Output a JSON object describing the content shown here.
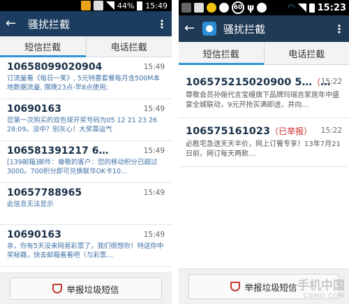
{
  "left": {
    "status": {
      "battery": "44%",
      "time": "15:49"
    },
    "appbar": {
      "title": "骚扰拦截"
    },
    "tabs": [
      {
        "label": "短信拦截"
      },
      {
        "label": "电话拦截"
      }
    ],
    "messages": [
      {
        "number": "10658099020904",
        "time": "15:49",
        "preview": "订流量看《每日一笑》, 5元特惠套餐每月含500M本地数据流量, 限晚23点-早8点使用;"
      },
      {
        "number": "10690163",
        "time": "15:49",
        "preview": "您第一次购买的双色球开奖号码为05 12 21 23 26 28:09。没中？别灰心！大奖靠运气"
      },
      {
        "number": "106581391217 6313…",
        "time": "15:49",
        "preview": "[139邮箱]邮件：尊敬的客户：您的移动积分已超过3000。700积分即可兑换联华OK卡10…"
      },
      {
        "number": "10657788965",
        "time": "15:49",
        "preview": "此信息无法显示"
      },
      {
        "number": "10690163",
        "time": "15:49",
        "preview": "亲，你有5天没来网易彩票了，我们很想你！特送你中奖秘籍，快去邮箱看看吧（与彩票…"
      }
    ],
    "report_button": "举报垃圾短信"
  },
  "right": {
    "status": {
      "badge": "60",
      "time": "15:23"
    },
    "appbar": {
      "title": "骚扰拦截"
    },
    "tabs": [
      {
        "label": "短信拦截"
      },
      {
        "label": "电话拦截"
      }
    ],
    "messages": [
      {
        "number": "106575215020900 5…",
        "tag": "（已举报）",
        "time": "15:22",
        "preview": "尊敬会员孙俪代言宝缦旗下品牌玛瑞吉家居年中盛宴全城联动，9元开抢买满即送，并向…"
      },
      {
        "number": "106575161023",
        "tag": "（已举报）",
        "time": "15:22",
        "preview": "必胜宅急送天天半价，网上订餐专享！13年7月21日前，网订每天两款…"
      }
    ],
    "report_button": "举报垃圾短信"
  },
  "watermark": {
    "main": "手机中国",
    "sub": "CNMO.COM"
  },
  "colors": {
    "appbar": "#1c3d5f",
    "tab_indicator": "#2f95d6",
    "reported_tag": "#d12a2a",
    "preview_left": "#3e70a6"
  }
}
